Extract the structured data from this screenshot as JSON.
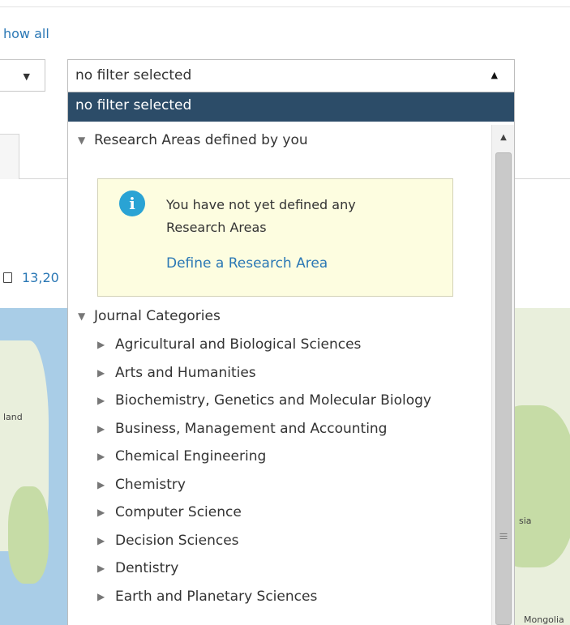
{
  "header": {
    "show_all_link": "how all"
  },
  "stats": {
    "document_count": "13,20"
  },
  "map": {
    "labels": [
      "land",
      "sia",
      "Mongolia"
    ]
  },
  "filter": {
    "current_value": "no filter selected",
    "selected_option": "no filter selected",
    "research_areas": {
      "heading": "Research Areas defined by you",
      "message": "You have not yet defined any Research Areas",
      "link": "Define a Research Area"
    },
    "journal_categories": {
      "heading": "Journal Categories",
      "items": [
        "Agricultural and Biological Sciences",
        "Arts and Humanities",
        "Biochemistry, Genetics and Molecular Biology",
        "Business, Management and Accounting",
        "Chemical Engineering",
        "Chemistry",
        "Computer Science",
        "Decision Sciences",
        "Dentistry",
        "Earth and Planetary Sciences"
      ]
    }
  },
  "colors": {
    "accent_link": "#2b78b5",
    "selected_option_bg": "#2c4c68",
    "info_box_bg": "#fdfde0",
    "info_icon": "#2aa3d4"
  },
  "icons": [
    "chevron-down-icon",
    "chevron-up-icon",
    "info-icon",
    "document-icon",
    "triangle-down-icon",
    "triangle-right-icon",
    "scroll-up-icon"
  ]
}
